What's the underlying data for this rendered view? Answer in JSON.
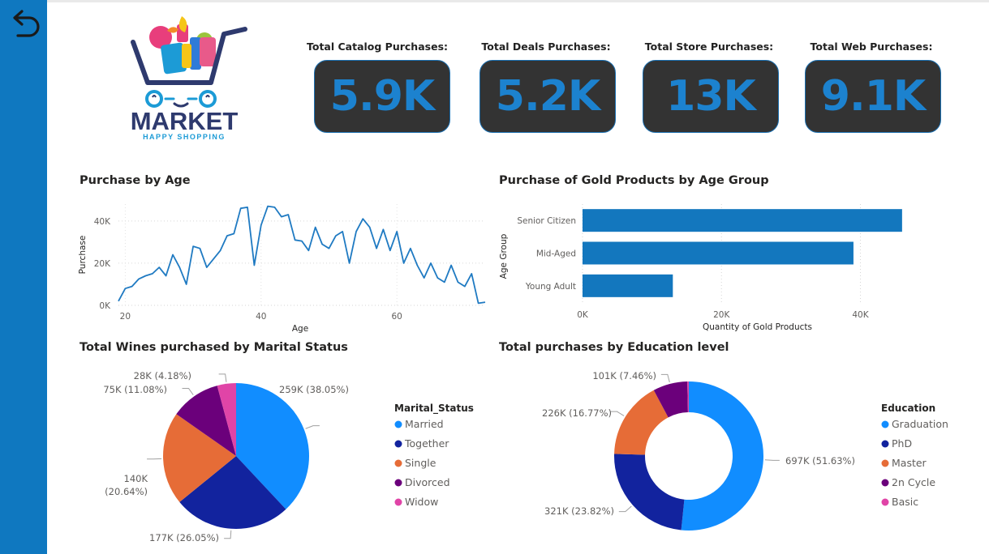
{
  "kpis": [
    {
      "label": "Total Catalog Purchases:",
      "value": "5.9K"
    },
    {
      "label": "Total Deals Purchases:",
      "value": "5.2K"
    },
    {
      "label": "Total Store Purchases:",
      "value": "13K"
    },
    {
      "label": "Total Web Purchases:",
      "value": "9.1K"
    }
  ],
  "logo": {
    "title": "MARKET",
    "tagline": "HAPPY SHOPPING"
  },
  "icons": {
    "back": "back-arrow-icon",
    "logo": "shopping-cart-logo"
  },
  "colors": {
    "sidebar": "#0F78C0",
    "kpi_bg": "#333333",
    "kpi_value": "#1C82CF",
    "line": "#1F7AC2",
    "bar": "#1377BE",
    "married": "#118DFF",
    "together": "#12239E",
    "single": "#E66C37",
    "divorced": "#6B007B",
    "widow": "#E044A7"
  },
  "chart_data": [
    {
      "type": "line",
      "title": "Purchase by Age",
      "xlabel": "Age",
      "ylabel": "Purchase",
      "xlim": [
        19,
        73
      ],
      "ylim": [
        0,
        48000
      ],
      "xticks": [
        "20",
        "40",
        "60"
      ],
      "yticks": [
        "0K",
        "20K",
        "40K"
      ],
      "x": [
        19,
        20,
        21,
        22,
        23,
        24,
        25,
        26,
        27,
        28,
        29,
        30,
        31,
        32,
        33,
        34,
        35,
        36,
        37,
        38,
        39,
        40,
        41,
        42,
        43,
        44,
        45,
        46,
        47,
        48,
        49,
        50,
        51,
        52,
        53,
        54,
        55,
        56,
        57,
        58,
        59,
        60,
        61,
        62,
        63,
        64,
        65,
        66,
        67,
        68,
        69,
        70,
        71,
        72,
        73
      ],
      "y": [
        2000,
        8000,
        9000,
        12500,
        14000,
        15000,
        18000,
        14000,
        24000,
        18000,
        10000,
        28000,
        27000,
        18000,
        22000,
        26000,
        33000,
        34000,
        46000,
        46500,
        19000,
        38000,
        47000,
        46500,
        42000,
        43000,
        31000,
        30500,
        26000,
        37000,
        29000,
        27000,
        33000,
        35000,
        20000,
        35000,
        41000,
        37000,
        27000,
        36000,
        26000,
        35000,
        20000,
        27000,
        19000,
        13000,
        20000,
        13000,
        11000,
        19000,
        11000,
        9000,
        15000,
        1000,
        1500
      ],
      "grid": true
    },
    {
      "type": "bar",
      "orientation": "horizontal",
      "title": "Purchase of Gold Products by Age Group",
      "xlabel": "Quantity of Gold Products",
      "ylabel": "Age Group",
      "categories": [
        "Senior Citizen",
        "Mid-Aged",
        "Young Adult"
      ],
      "values": [
        46000,
        39000,
        13000
      ],
      "xlim": [
        0,
        48000
      ],
      "xticks": [
        "0K",
        "20K",
        "40K"
      ],
      "grid": true
    },
    {
      "type": "pie",
      "title": "Total Wines purchased by Marital Status",
      "legend_title": "Marital_Status",
      "legend_position": "right",
      "slices": [
        {
          "name": "Married",
          "value": 259000,
          "percent": 38.05,
          "label": "259K (38.05%)",
          "color": "#118DFF"
        },
        {
          "name": "Together",
          "value": 177000,
          "percent": 26.05,
          "label": "177K (26.05%)",
          "color": "#12239E"
        },
        {
          "name": "Single",
          "value": 140000,
          "percent": 20.64,
          "label_lines": [
            "140K",
            "(20.64%)"
          ],
          "color": "#E66C37"
        },
        {
          "name": "Divorced",
          "value": 75000,
          "percent": 11.08,
          "label": "75K (11.08%)",
          "color": "#6B007B"
        },
        {
          "name": "Widow",
          "value": 28000,
          "percent": 4.18,
          "label": "28K (4.18%)",
          "color": "#E044A7"
        }
      ]
    },
    {
      "type": "donut",
      "title": "Total purchases by Education level",
      "legend_title": "Education",
      "legend_position": "right",
      "slices": [
        {
          "name": "Graduation",
          "value": 697000,
          "percent": 51.63,
          "label": "697K (51.63%)",
          "color": "#118DFF"
        },
        {
          "name": "PhD",
          "value": 321000,
          "percent": 23.82,
          "label": "321K (23.82%)",
          "color": "#12239E"
        },
        {
          "name": "Master",
          "value": 226000,
          "percent": 16.77,
          "label": "226K (16.77%)",
          "color": "#E66C37"
        },
        {
          "name": "2n Cycle",
          "value": 101000,
          "percent": 7.46,
          "label": "101K (7.46%)",
          "color": "#6B007B"
        },
        {
          "name": "Basic",
          "value": 4000,
          "percent": 0.32,
          "label": "",
          "color": "#E044A7"
        }
      ]
    }
  ]
}
